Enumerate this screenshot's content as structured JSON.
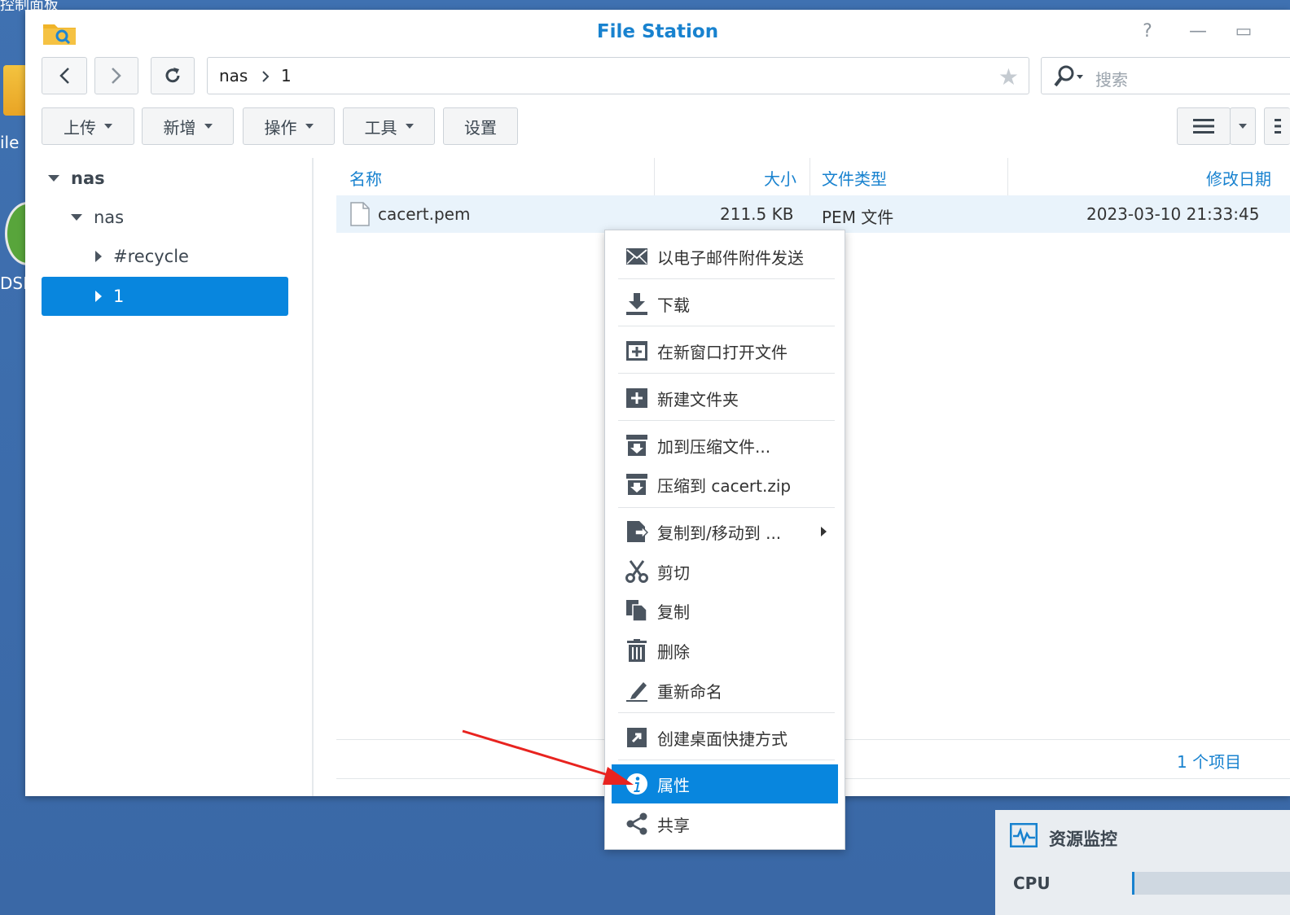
{
  "desktop": {
    "top_label": "控制面板",
    "icon1_label": "ile S",
    "icon2_label": "DSI"
  },
  "window": {
    "title": "File Station",
    "controls": {
      "help": "?",
      "minimize": "—",
      "maximize": "▭"
    }
  },
  "nav": {
    "path": [
      "nas",
      "1"
    ],
    "search_placeholder": "搜索"
  },
  "toolbar": {
    "upload": "上传",
    "create": "新增",
    "action": "操作",
    "tools": "工具",
    "settings": "设置"
  },
  "tree": {
    "root": "nas",
    "share": "nas",
    "children": [
      "#recycle",
      "1"
    ],
    "selected": "1"
  },
  "grid": {
    "columns": [
      "名称",
      "大小",
      "文件类型",
      "修改日期"
    ],
    "rows": [
      {
        "name": "cacert.pem",
        "size": "211.5 KB",
        "type": "PEM 文件",
        "modified": "2023-03-10 21:33:45"
      }
    ],
    "status": "1 个项目"
  },
  "context_menu": {
    "items": [
      {
        "label": "以电子邮件附件发送",
        "icon": "mail-icon"
      },
      {
        "label": "下载",
        "icon": "download-icon"
      },
      {
        "label": "在新窗口打开文件",
        "icon": "open-window-icon"
      },
      {
        "label": "新建文件夹",
        "icon": "new-folder-icon"
      },
      {
        "label": "加到压缩文件...",
        "icon": "archive-icon"
      },
      {
        "label": "压缩到 cacert.zip",
        "icon": "archive-icon"
      },
      {
        "label": "复制到/移动到 ...",
        "icon": "copy-move-icon"
      },
      {
        "label": "剪切",
        "icon": "scissors-icon"
      },
      {
        "label": "复制",
        "icon": "copy-icon"
      },
      {
        "label": "删除",
        "icon": "trash-icon"
      },
      {
        "label": "重新命名",
        "icon": "pencil-icon"
      },
      {
        "label": "创建桌面快捷方式",
        "icon": "shortcut-icon"
      },
      {
        "label": "属性",
        "icon": "info-icon"
      },
      {
        "label": "共享",
        "icon": "share-icon"
      }
    ],
    "selected": "属性"
  },
  "widget": {
    "title": "资源监控",
    "cpu_label": "CPU"
  },
  "colors": {
    "accent": "#1882cf",
    "selection": "#0886de",
    "desktop": "#3d6dab",
    "annotation_arrow": "#e8231f"
  }
}
